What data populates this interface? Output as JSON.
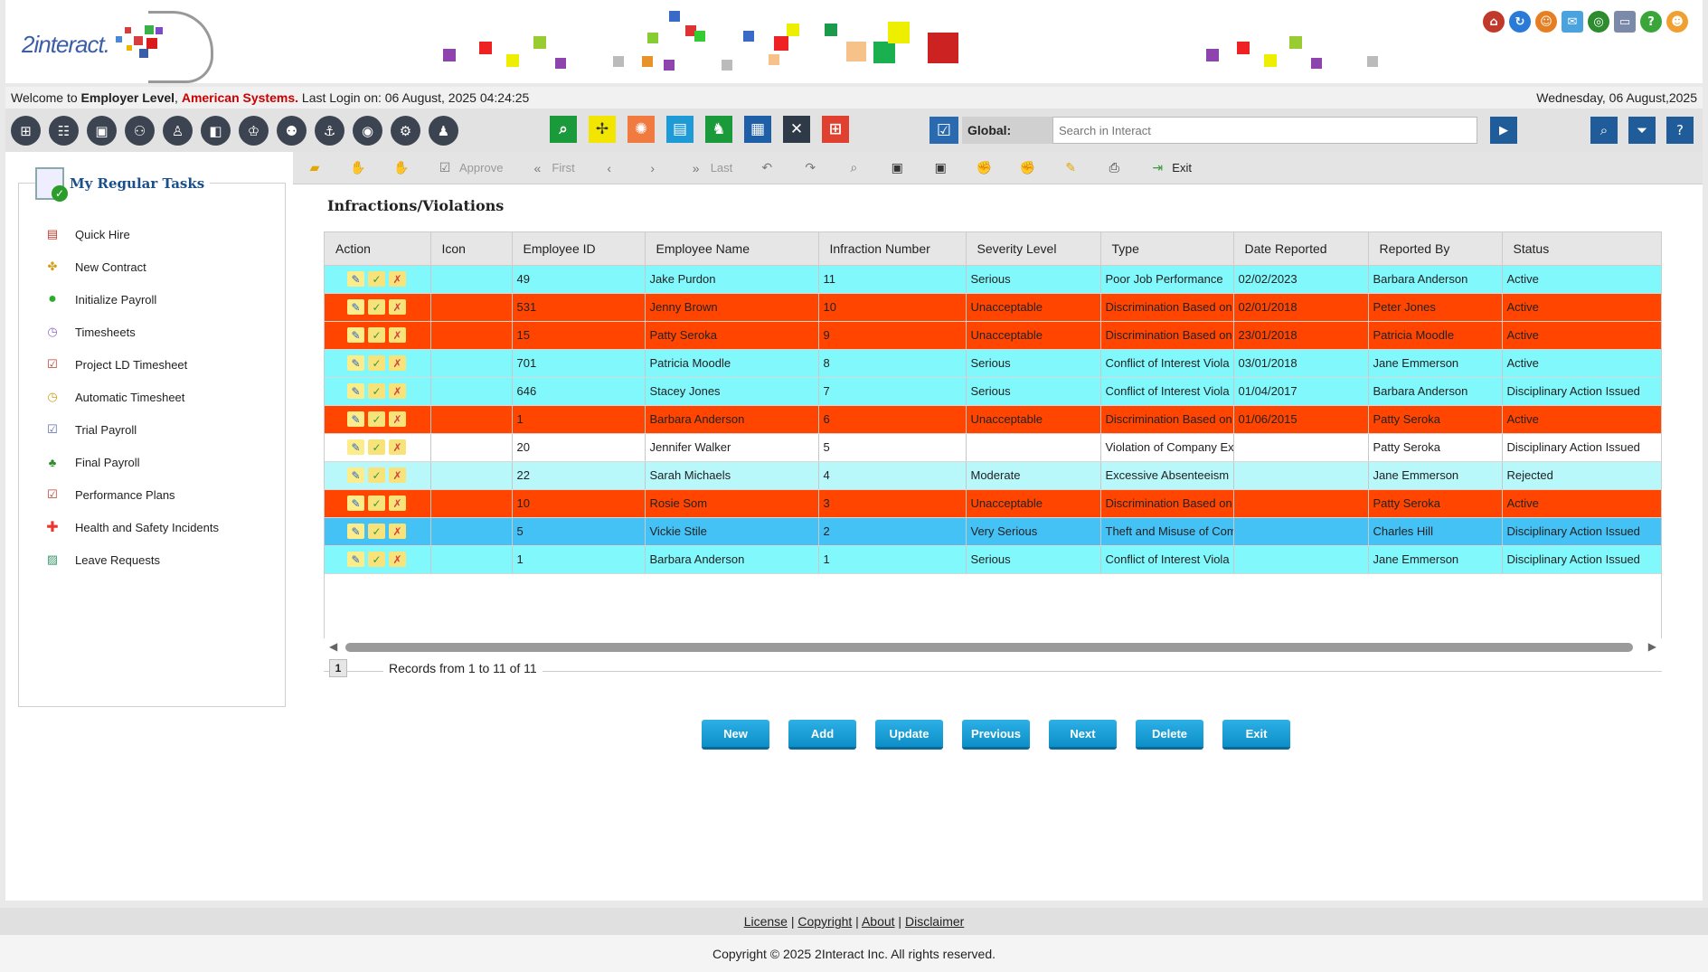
{
  "app": {
    "logo_text": "2interact."
  },
  "welcome": {
    "prefix": "Welcome to ",
    "level": "Employer Level",
    "sep": ", ",
    "company": "American Systems.",
    "last_login": " Last Login on: 06 August, 2025 04:24:25",
    "date": "Wednesday, 06 August,2025"
  },
  "global_search": {
    "label": "Global:",
    "placeholder": "Search in Interact"
  },
  "sidebar": {
    "title": "My Regular Tasks",
    "items": [
      {
        "label": "Quick Hire",
        "icon": "document-icon"
      },
      {
        "label": "New Contract",
        "icon": "handshake-icon"
      },
      {
        "label": "Initialize Payroll",
        "icon": "green-circle-icon"
      },
      {
        "label": "Timesheets",
        "icon": "clock-icon"
      },
      {
        "label": "Project LD Timesheet",
        "icon": "checklist-icon"
      },
      {
        "label": "Automatic Timesheet",
        "icon": "clock-icon"
      },
      {
        "label": "Trial Payroll",
        "icon": "checklist-icon"
      },
      {
        "label": "Final Payroll",
        "icon": "people-icon"
      },
      {
        "label": "Performance Plans",
        "icon": "checklist-icon"
      },
      {
        "label": "Health and Safety Incidents",
        "icon": "first-aid-icon"
      },
      {
        "label": "Leave Requests",
        "icon": "landscape-icon"
      }
    ]
  },
  "action_bar": {
    "approve": "Approve",
    "first": "First",
    "last": "Last",
    "exit": "Exit"
  },
  "page": {
    "title": "Infractions/Violations"
  },
  "table": {
    "headers": [
      "Action",
      "Icon",
      "Employee ID",
      "Employee Name",
      "Infraction Number",
      "Severity Level",
      "Type",
      "Date Reported",
      "Reported By",
      "Status"
    ],
    "rows": [
      {
        "style": "cyan",
        "id": "49",
        "name": "Jake Purdon",
        "num": "11",
        "severity": "Serious",
        "type": "Poor Job Performance",
        "date": "02/02/2023",
        "by": "Barbara Anderson",
        "status": "Active"
      },
      {
        "style": "red",
        "id": "531",
        "name": "Jenny Brown",
        "num": "10",
        "severity": "Unacceptable",
        "type": "Discrimination Based on",
        "date": "02/01/2018",
        "by": "Peter Jones",
        "status": "Active"
      },
      {
        "style": "red",
        "id": "15",
        "name": "Patty Seroka",
        "num": "9",
        "severity": "Unacceptable",
        "type": "Discrimination Based on",
        "date": "23/01/2018",
        "by": "Patricia Moodle",
        "status": "Active"
      },
      {
        "style": "cyan",
        "id": "701",
        "name": "Patricia Moodle",
        "num": "8",
        "severity": "Serious",
        "type": "Conflict of Interest Viola",
        "date": "03/01/2018",
        "by": "Jane Emmerson",
        "status": "Active"
      },
      {
        "style": "cyan",
        "id": "646",
        "name": "Stacey Jones",
        "num": "7",
        "severity": "Serious",
        "type": "Conflict of Interest Viola",
        "date": "01/04/2017",
        "by": "Barbara Anderson",
        "status": "Disciplinary Action Issued"
      },
      {
        "style": "red",
        "id": "1",
        "name": "Barbara Anderson",
        "num": "6",
        "severity": "Unacceptable",
        "type": "Discrimination Based on",
        "date": "01/06/2015",
        "by": "Patty Seroka",
        "status": "Active"
      },
      {
        "style": "white",
        "id": "20",
        "name": "Jennifer Walker",
        "num": "5",
        "severity": "",
        "type": "Violation of Company Ex",
        "date": "",
        "by": "Patty Seroka",
        "status": "Disciplinary Action Issued"
      },
      {
        "style": "light",
        "id": "22",
        "name": "Sarah Michaels",
        "num": "4",
        "severity": "Moderate",
        "type": "Excessive Absenteeism",
        "date": "",
        "by": "Jane Emmerson",
        "status": "Rejected"
      },
      {
        "style": "red",
        "id": "10",
        "name": "Rosie Som",
        "num": "3",
        "severity": "Unacceptable",
        "type": "Discrimination Based on",
        "date": "",
        "by": "Patty Seroka",
        "status": "Active"
      },
      {
        "style": "blue",
        "id": "5",
        "name": "Vickie Stile",
        "num": "2",
        "severity": "Very Serious",
        "type": "Theft and Misuse of Com",
        "date": "",
        "by": "Charles Hill",
        "status": "Disciplinary Action Issued"
      },
      {
        "style": "cyan",
        "id": "1",
        "name": "Barbara Anderson",
        "num": "1",
        "severity": "Serious",
        "type": "Conflict of Interest Viola",
        "date": "",
        "by": "Jane Emmerson",
        "status": "Disciplinary Action Issued"
      }
    ]
  },
  "pager": {
    "page": "1",
    "records": "Records from 1 to 11 of 11"
  },
  "buttons": {
    "new": "New",
    "add": "Add",
    "update": "Update",
    "previous": "Previous",
    "next": "Next",
    "delete": "Delete",
    "exit": "Exit"
  },
  "footer": {
    "license": "License",
    "copyright_link": "Copyright",
    "about": "About",
    "disclaimer": "Disclaimer",
    "sep": " | ",
    "copyright": "Copyright © 2025 2Interact Inc. All rights reserved."
  },
  "colors": {
    "row_cyan": "#80f8fc",
    "row_red": "#ff4500",
    "row_light": "#b8f8fb",
    "row_blue": "#44c2f6",
    "accent": "#1f5c99"
  }
}
